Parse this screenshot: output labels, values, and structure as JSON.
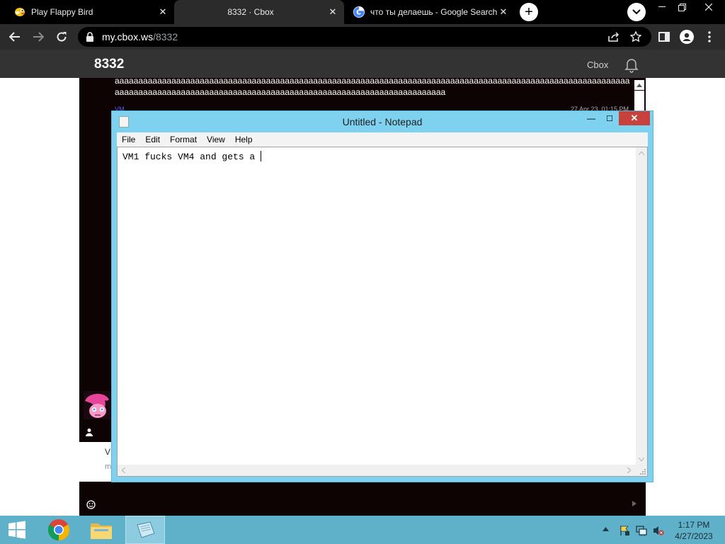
{
  "browser": {
    "tabs": [
      {
        "title": "Play Flappy Bird",
        "icon": "flappy-bird-icon"
      },
      {
        "title": "8332 · Cbox",
        "icon": "none"
      },
      {
        "title": "что ты делаешь - Google Search",
        "icon": "google-icon"
      }
    ],
    "close_glyph": "✕",
    "new_tab_glyph": "+",
    "address": {
      "host": "my.cbox.ws",
      "path": "/8332"
    }
  },
  "page": {
    "title": "8332",
    "cbox_link": "Cbox",
    "chat_message": "aaaaaaaaaaaaaaaaaaaaaaaaaaaaaaaaaaaaaaaaaaaaaaaaaaaaaaaaaaaaaaaaaaaaaaaaaaaaaaaaaaaaaaaaaaaaaaaaaaaaaaaaaaaaaaaaaaaaaaaaaaaaaaaaaaaaaaaaaaaaaaaaaaaaaaaaaaaaaaaaaaaaaaaaaaaaaaaaaaa",
    "chat_user": "VM",
    "chat_date": "27 Apr 23, 01:15 PM",
    "input_partial_v": "V",
    "input_partial_m": "m"
  },
  "notepad": {
    "title": "Untitled - Notepad",
    "menu": [
      "File",
      "Edit",
      "Format",
      "View",
      "Help"
    ],
    "text": "VM1 fucks VM4 and gets a ",
    "controls": {
      "minimize": "—",
      "maximize": "☐",
      "close": "✕"
    }
  },
  "taskbar": {
    "apps": [
      "start-button",
      "chrome",
      "file-explorer",
      "notepad"
    ],
    "time": "1:17 PM",
    "date": "4/27/2023"
  },
  "colors": {
    "tabstrip": "#000000",
    "toolbar": "#2b2b2b",
    "page_header": "#333333",
    "notepad_frame": "#7ed2ef",
    "close_button": "#c7423c",
    "taskbar": "#5fb1c9"
  }
}
